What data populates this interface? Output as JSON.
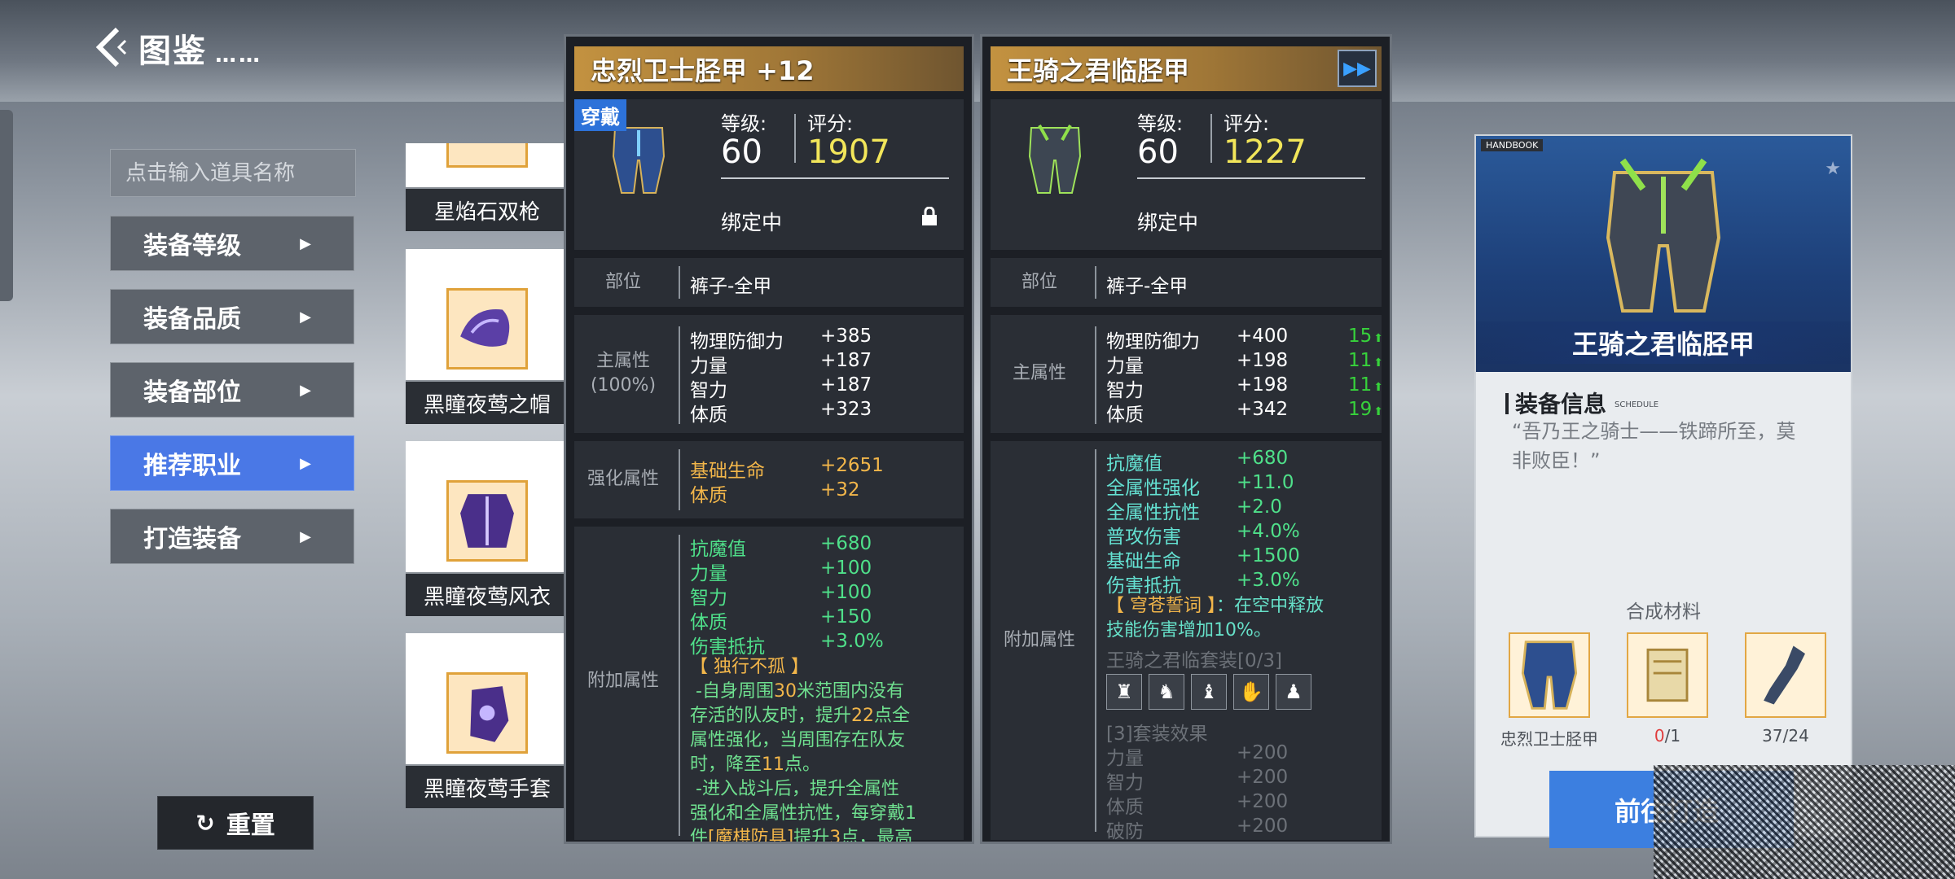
{
  "header": {
    "title": "图鉴",
    "title_dots": "……",
    "back_icon": "back-arrow-icon"
  },
  "sidebar": {
    "search_placeholder": "点击输入道具名称",
    "filters": [
      {
        "label": "装备等级",
        "active": false
      },
      {
        "label": "装备品质",
        "active": false
      },
      {
        "label": "装备部位",
        "active": false
      },
      {
        "label": "推荐职业",
        "active": true
      },
      {
        "label": "打造装备",
        "active": false
      }
    ],
    "reset_label": "重置"
  },
  "item_list": [
    {
      "name": "星焰石双枪"
    },
    {
      "name": "黑瞳夜莺之帽"
    },
    {
      "name": "黑瞳夜莺风衣"
    },
    {
      "name": "黑瞳夜莺手套"
    }
  ],
  "equipped": {
    "title": "忠烈卫士胫甲 +12",
    "badge": "穿戴",
    "level_label": "等级:",
    "level": "60",
    "score_label": "评分:",
    "score": "1907",
    "bind": "绑定中",
    "slot_label": "部位",
    "slot_value": "裤子-全甲",
    "main_label": "主属性",
    "main_pct": "(100%)",
    "main_stats": [
      {
        "k": "物理防御力",
        "v": "+385"
      },
      {
        "k": "力量",
        "v": "+187"
      },
      {
        "k": "智力",
        "v": "+187"
      },
      {
        "k": "体质",
        "v": "+323"
      }
    ],
    "enh_label": "强化属性",
    "enh_stats": [
      {
        "k": "基础生命",
        "v": "+2651"
      },
      {
        "k": "体质",
        "v": "+32"
      }
    ],
    "extra_label": "附加属性",
    "extra_stats": [
      {
        "k": "抗魔值",
        "v": "+680"
      },
      {
        "k": "力量",
        "v": "+100"
      },
      {
        "k": "智力",
        "v": "+100"
      },
      {
        "k": "体质",
        "v": "+150"
      },
      {
        "k": "伤害抵抗",
        "v": "+3.0%"
      }
    ],
    "skill_name": "【 独行不孤 】",
    "skill_l1a": "-自身周围",
    "skill_l1b": "30",
    "skill_l1c": "米范围内没有",
    "skill_l2a": "存活的队友时，提升",
    "skill_l2b": "22",
    "skill_l2c": "点全",
    "skill_l3": "属性强化，当周围存在队友",
    "skill_l4a": "时，降至",
    "skill_l4b": "11",
    "skill_l4c": "点。",
    "skill_l5": "-进入战斗后，提升全属性",
    "skill_l6": "强化和全属性抗性，每穿戴1",
    "skill_l7a": "件",
    "skill_l7b": "[魔棋防具]",
    "skill_l7c": "提升",
    "skill_l7d": "3",
    "skill_l7e": "点，最高"
  },
  "compare": {
    "title": "王骑之君临胫甲",
    "ff_icon": "fast-forward-icon",
    "level_label": "等级:",
    "level": "60",
    "score_label": "评分:",
    "score": "1227",
    "bind": "绑定中",
    "slot_label": "部位",
    "slot_value": "裤子-全甲",
    "main_label": "主属性",
    "main_stats": [
      {
        "k": "物理防御力",
        "v": "+400",
        "up": "15"
      },
      {
        "k": "力量",
        "v": "+198",
        "up": "11"
      },
      {
        "k": "智力",
        "v": "+198",
        "up": "11"
      },
      {
        "k": "体质",
        "v": "+342",
        "up": "19"
      }
    ],
    "extra_label": "附加属性",
    "extra_stats": [
      {
        "k": "抗魔值",
        "v": "+680"
      },
      {
        "k": "全属性强化",
        "v": "+11.0"
      },
      {
        "k": "全属性抗性",
        "v": "+2.0"
      },
      {
        "k": "普攻伤害",
        "v": "+4.0%"
      },
      {
        "k": "基础生命",
        "v": "+1500"
      },
      {
        "k": "伤害抵抗",
        "v": "+3.0%"
      }
    ],
    "skill_name": "【 穹苍誓词 】",
    "skill_desc_a": "：在空中释放",
    "skill_desc_b": "技能伤害增加10%。",
    "set_name": "王骑之君临套装[0/3]",
    "set_effect_label": "[3]套装效果",
    "set_stats": [
      {
        "k": "力量",
        "v": "+200"
      },
      {
        "k": "智力",
        "v": "+200"
      },
      {
        "k": "体质",
        "v": "+200"
      },
      {
        "k": "破防",
        "v": "+200"
      }
    ]
  },
  "card": {
    "handbook_tag": "HANDBOOK",
    "name": "王骑之君临胫甲",
    "section": "装备信息",
    "schedule_tag": "SCHEDULE",
    "quote_a": "“吾乃王之骑士——铁蹄所至，莫",
    "quote_b": "非败臣！”",
    "materials_title": "合成材料",
    "materials": [
      {
        "label": "忠烈卫士胫甲",
        "count_have": "",
        "count_need": ""
      },
      {
        "label": "",
        "count_have": "0",
        "count_need": "/1"
      },
      {
        "label": "37/24",
        "count_have": "",
        "count_need": ""
      }
    ],
    "go_label": "前往打造"
  },
  "colors": {
    "accent": "#4a78e6",
    "gold": "#f2b64a",
    "score": "#f2e65a",
    "green_up": "#37d23b",
    "affix": "#6fe08f"
  }
}
